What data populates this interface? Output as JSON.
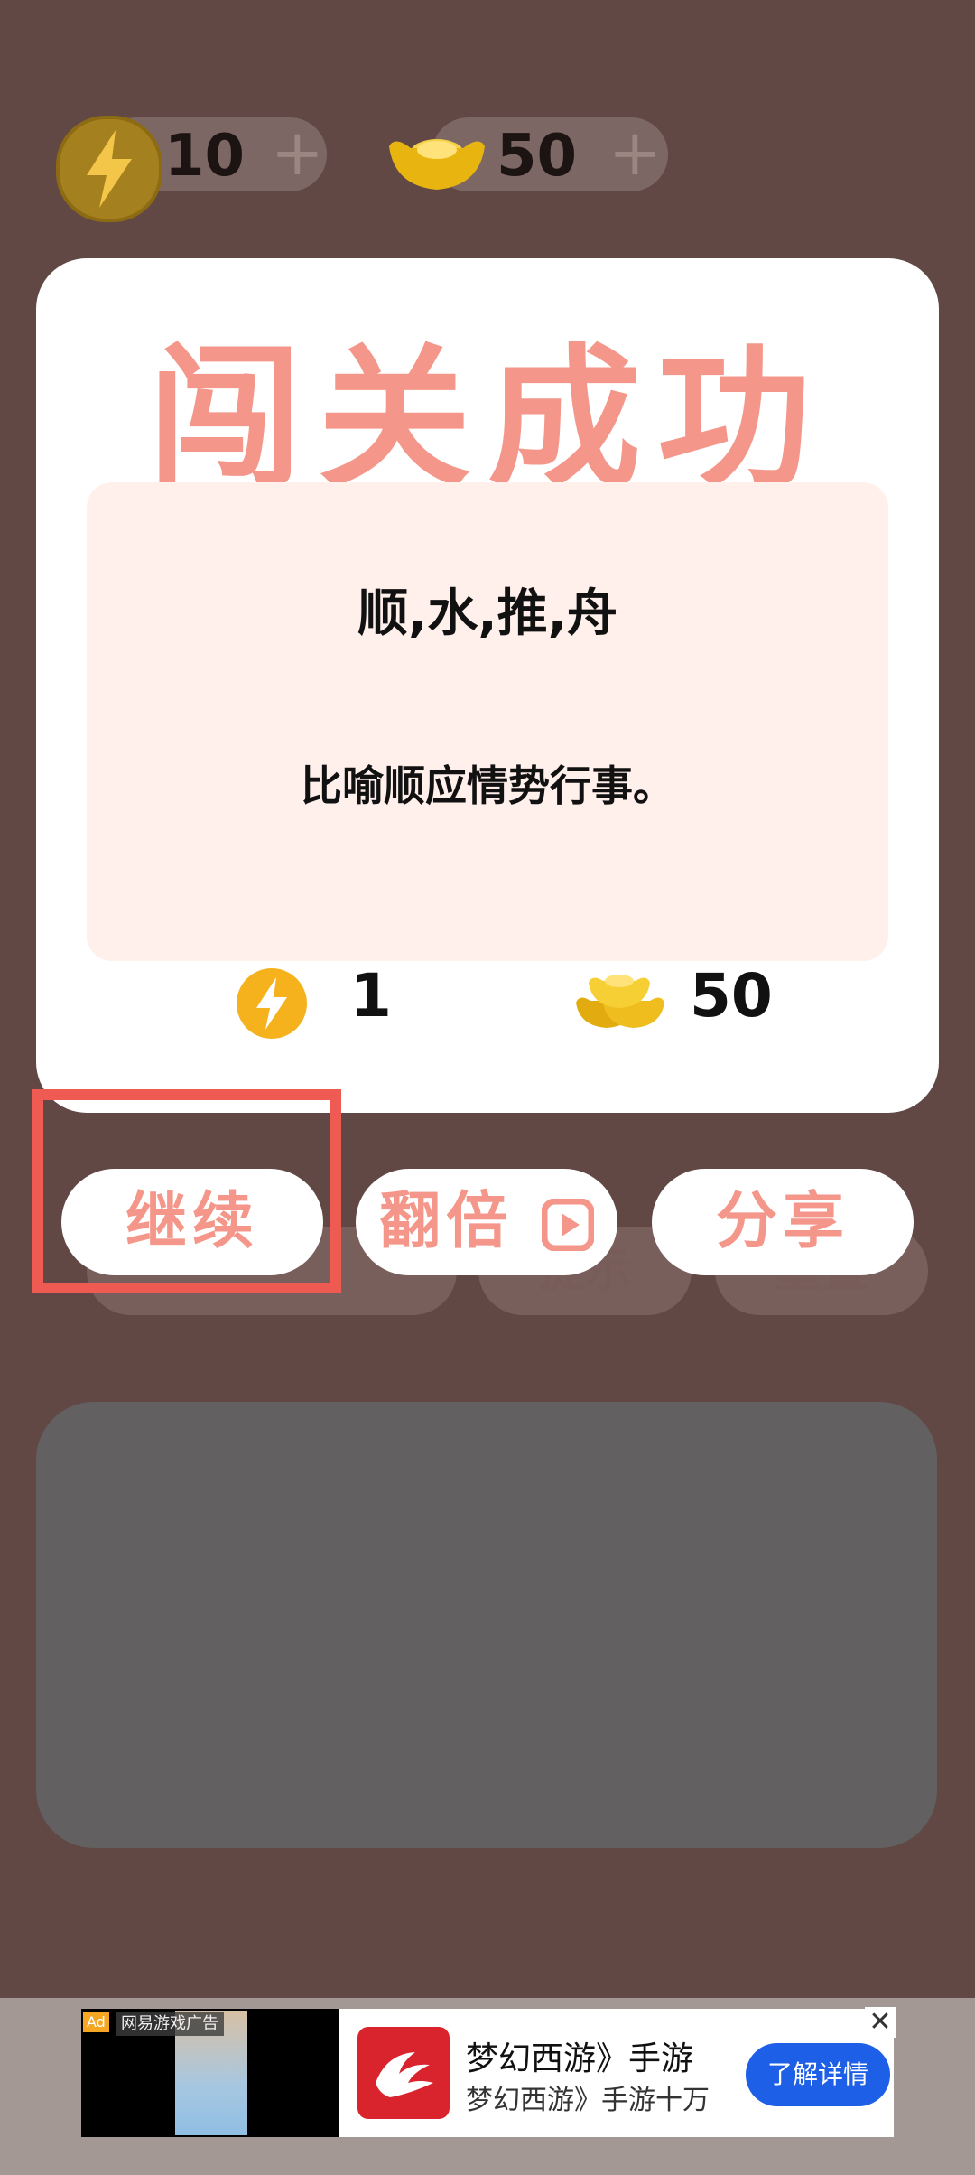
{
  "header": {
    "energy_value": "10",
    "gold_value": "50",
    "plus_symbol": "+"
  },
  "modal": {
    "title": "闯关成功",
    "idiom_words": "顺,水,推,舟",
    "idiom_meaning": "比喻顺应情势行事。",
    "reward_energy": "1",
    "reward_gold": "50"
  },
  "buttons": {
    "continue": "继续",
    "double": "翻倍",
    "share": "分享"
  },
  "background_buttons": {
    "b1": "",
    "b2": "提示",
    "b3": "重置"
  },
  "ad": {
    "tag": "Ad",
    "source": "网易游戏广告",
    "title": "梦幻西游》手游",
    "subtitle": "梦幻西游》手游十万",
    "cta": "了解详情",
    "close": "✕"
  },
  "colors": {
    "background": "#614845",
    "accent": "#f4978a",
    "highlight": "#ef5b53"
  }
}
